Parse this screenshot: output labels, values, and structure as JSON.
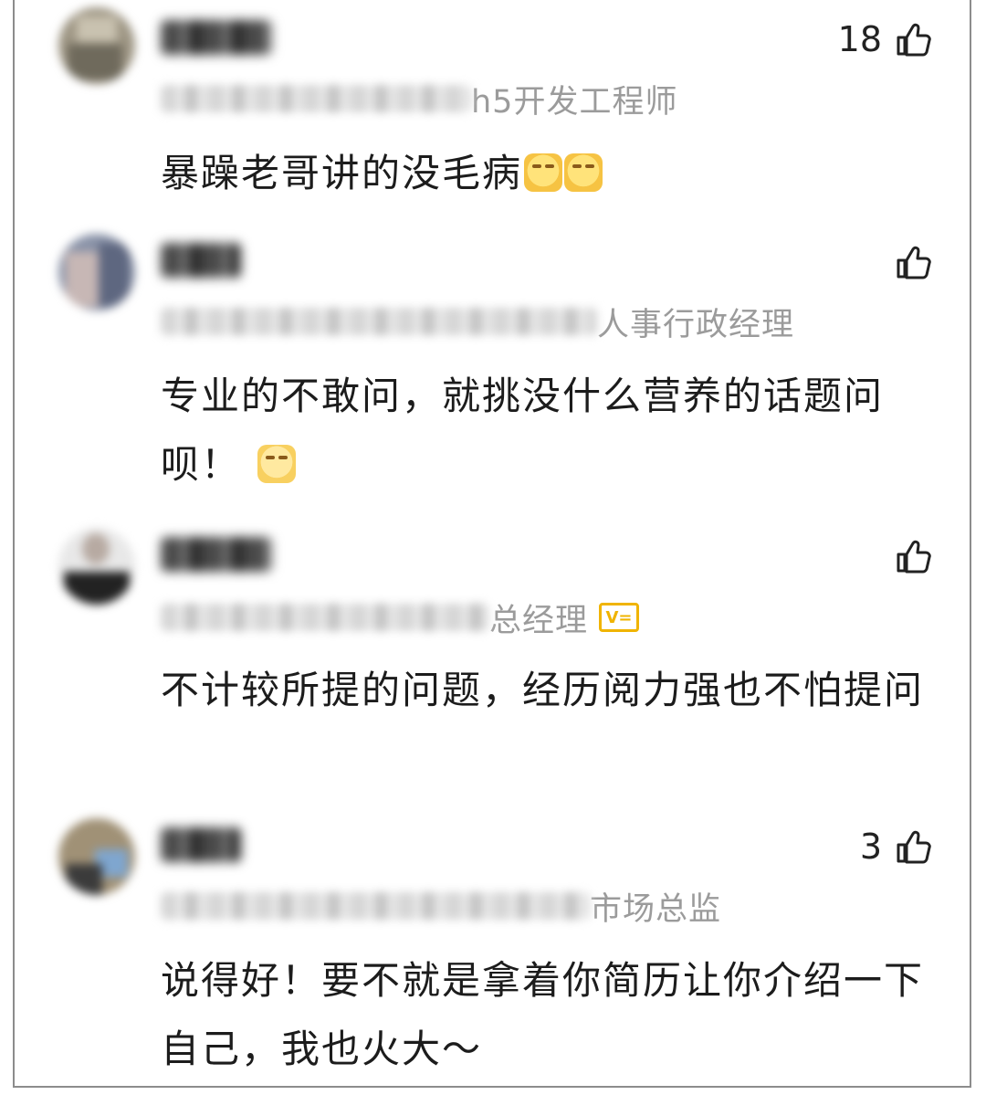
{
  "comments": [
    {
      "job_title": "h5开发工程师",
      "text": "暴躁老哥讲的没毛病",
      "like_count": "18",
      "has_v_badge": false,
      "emojis": [
        "grinning-sweat-emoji",
        "grinning-sweat-emoji"
      ]
    },
    {
      "job_title": "人事行政经理",
      "text": "专业的不敢问，就挑没什么营养的话题问呗！",
      "like_count": "",
      "has_v_badge": false,
      "emojis": [
        "shy-smile-emoji"
      ]
    },
    {
      "job_title": "总经理",
      "text": "不计较所提的问题，经历阅力强也不怕提问",
      "like_count": "",
      "has_v_badge": true,
      "v_badge_text": "V=",
      "emojis": []
    },
    {
      "job_title": "市场总监",
      "text": "说得好！要不就是拿着你简历让你介绍一下自己，我也火大～",
      "like_count": "3",
      "has_v_badge": false,
      "emojis": []
    }
  ],
  "icons": {
    "like": "thumbs-up-icon",
    "verified": "v-badge-icon"
  },
  "colors": {
    "text": "#1c1c1c",
    "secondary": "#9b9b9b",
    "badge": "#f0b400",
    "border": "#8c8c8c"
  }
}
